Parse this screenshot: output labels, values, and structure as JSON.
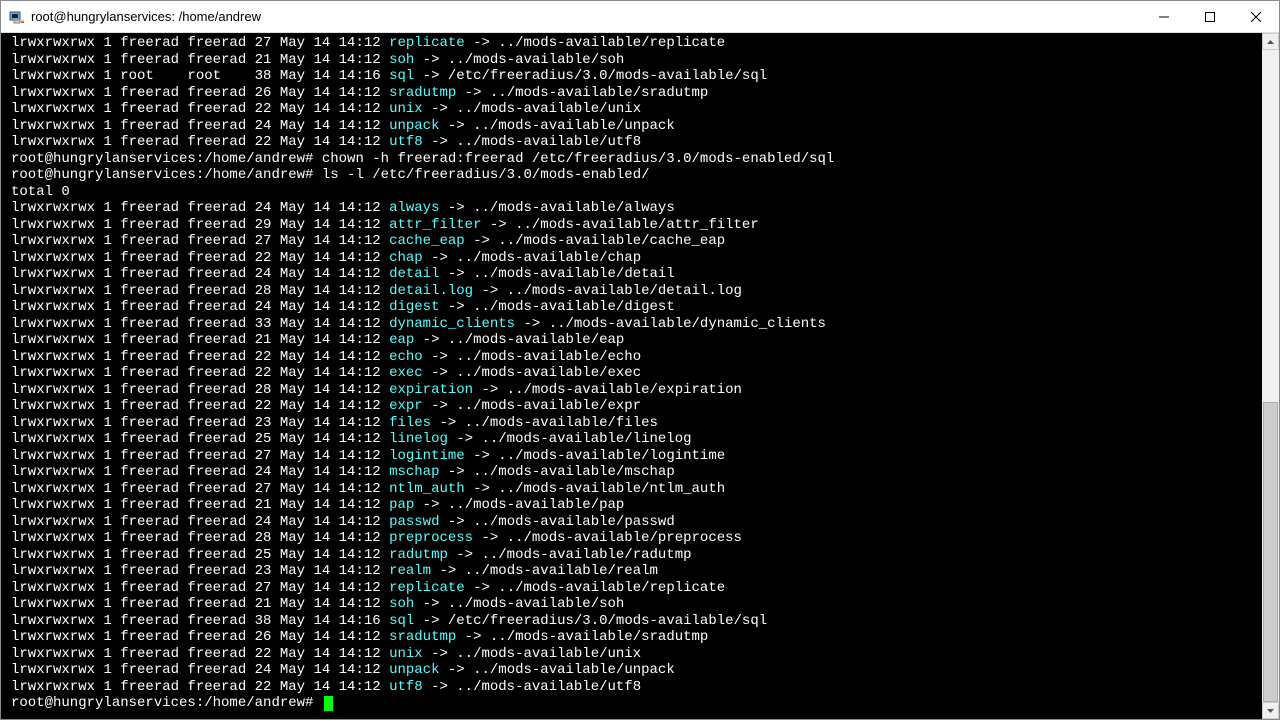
{
  "window": {
    "title": "root@hungrylanservices: /home/andrew"
  },
  "prompt": "root@hungrylanservices:/home/andrew#",
  "cmd_chown": "chown -h freerad:freerad /etc/freeradius/3.0/mods-enabled/sql",
  "cmd_ls": "ls -l /etc/freeradius/3.0/mods-enabled/",
  "total_line": "total 0",
  "top_lines": [
    {
      "perm": "lrwxrwxrwx 1 freerad freerad 27 May 14 14:12 ",
      "name": "replicate",
      "arrow": " -> ../mods-available/replicate"
    },
    {
      "perm": "lrwxrwxrwx 1 freerad freerad 21 May 14 14:12 ",
      "name": "soh",
      "arrow": " -> ../mods-available/soh"
    },
    {
      "perm": "lrwxrwxrwx 1 root    root    38 May 14 14:16 ",
      "name": "sql",
      "arrow": " -> /etc/freeradius/3.0/mods-available/sql"
    },
    {
      "perm": "lrwxrwxrwx 1 freerad freerad 26 May 14 14:12 ",
      "name": "sradutmp",
      "arrow": " -> ../mods-available/sradutmp"
    },
    {
      "perm": "lrwxrwxrwx 1 freerad freerad 22 May 14 14:12 ",
      "name": "unix",
      "arrow": " -> ../mods-available/unix"
    },
    {
      "perm": "lrwxrwxrwx 1 freerad freerad 24 May 14 14:12 ",
      "name": "unpack",
      "arrow": " -> ../mods-available/unpack"
    },
    {
      "perm": "lrwxrwxrwx 1 freerad freerad 22 May 14 14:12 ",
      "name": "utf8",
      "arrow": " -> ../mods-available/utf8"
    }
  ],
  "listing": [
    {
      "perm": "lrwxrwxrwx 1 freerad freerad 24 May 14 14:12 ",
      "name": "always",
      "arrow": " -> ../mods-available/always"
    },
    {
      "perm": "lrwxrwxrwx 1 freerad freerad 29 May 14 14:12 ",
      "name": "attr_filter",
      "arrow": " -> ../mods-available/attr_filter"
    },
    {
      "perm": "lrwxrwxrwx 1 freerad freerad 27 May 14 14:12 ",
      "name": "cache_eap",
      "arrow": " -> ../mods-available/cache_eap"
    },
    {
      "perm": "lrwxrwxrwx 1 freerad freerad 22 May 14 14:12 ",
      "name": "chap",
      "arrow": " -> ../mods-available/chap"
    },
    {
      "perm": "lrwxrwxrwx 1 freerad freerad 24 May 14 14:12 ",
      "name": "detail",
      "arrow": " -> ../mods-available/detail"
    },
    {
      "perm": "lrwxrwxrwx 1 freerad freerad 28 May 14 14:12 ",
      "name": "detail.log",
      "arrow": " -> ../mods-available/detail.log"
    },
    {
      "perm": "lrwxrwxrwx 1 freerad freerad 24 May 14 14:12 ",
      "name": "digest",
      "arrow": " -> ../mods-available/digest"
    },
    {
      "perm": "lrwxrwxrwx 1 freerad freerad 33 May 14 14:12 ",
      "name": "dynamic_clients",
      "arrow": " -> ../mods-available/dynamic_clients"
    },
    {
      "perm": "lrwxrwxrwx 1 freerad freerad 21 May 14 14:12 ",
      "name": "eap",
      "arrow": " -> ../mods-available/eap"
    },
    {
      "perm": "lrwxrwxrwx 1 freerad freerad 22 May 14 14:12 ",
      "name": "echo",
      "arrow": " -> ../mods-available/echo"
    },
    {
      "perm": "lrwxrwxrwx 1 freerad freerad 22 May 14 14:12 ",
      "name": "exec",
      "arrow": " -> ../mods-available/exec"
    },
    {
      "perm": "lrwxrwxrwx 1 freerad freerad 28 May 14 14:12 ",
      "name": "expiration",
      "arrow": " -> ../mods-available/expiration"
    },
    {
      "perm": "lrwxrwxrwx 1 freerad freerad 22 May 14 14:12 ",
      "name": "expr",
      "arrow": " -> ../mods-available/expr"
    },
    {
      "perm": "lrwxrwxrwx 1 freerad freerad 23 May 14 14:12 ",
      "name": "files",
      "arrow": " -> ../mods-available/files"
    },
    {
      "perm": "lrwxrwxrwx 1 freerad freerad 25 May 14 14:12 ",
      "name": "linelog",
      "arrow": " -> ../mods-available/linelog"
    },
    {
      "perm": "lrwxrwxrwx 1 freerad freerad 27 May 14 14:12 ",
      "name": "logintime",
      "arrow": " -> ../mods-available/logintime"
    },
    {
      "perm": "lrwxrwxrwx 1 freerad freerad 24 May 14 14:12 ",
      "name": "mschap",
      "arrow": " -> ../mods-available/mschap"
    },
    {
      "perm": "lrwxrwxrwx 1 freerad freerad 27 May 14 14:12 ",
      "name": "ntlm_auth",
      "arrow": " -> ../mods-available/ntlm_auth"
    },
    {
      "perm": "lrwxrwxrwx 1 freerad freerad 21 May 14 14:12 ",
      "name": "pap",
      "arrow": " -> ../mods-available/pap"
    },
    {
      "perm": "lrwxrwxrwx 1 freerad freerad 24 May 14 14:12 ",
      "name": "passwd",
      "arrow": " -> ../mods-available/passwd"
    },
    {
      "perm": "lrwxrwxrwx 1 freerad freerad 28 May 14 14:12 ",
      "name": "preprocess",
      "arrow": " -> ../mods-available/preprocess"
    },
    {
      "perm": "lrwxrwxrwx 1 freerad freerad 25 May 14 14:12 ",
      "name": "radutmp",
      "arrow": " -> ../mods-available/radutmp"
    },
    {
      "perm": "lrwxrwxrwx 1 freerad freerad 23 May 14 14:12 ",
      "name": "realm",
      "arrow": " -> ../mods-available/realm"
    },
    {
      "perm": "lrwxrwxrwx 1 freerad freerad 27 May 14 14:12 ",
      "name": "replicate",
      "arrow": " -> ../mods-available/replicate"
    },
    {
      "perm": "lrwxrwxrwx 1 freerad freerad 21 May 14 14:12 ",
      "name": "soh",
      "arrow": " -> ../mods-available/soh"
    },
    {
      "perm": "lrwxrwxrwx 1 freerad freerad 38 May 14 14:16 ",
      "name": "sql",
      "arrow": " -> /etc/freeradius/3.0/mods-available/sql"
    },
    {
      "perm": "lrwxrwxrwx 1 freerad freerad 26 May 14 14:12 ",
      "name": "sradutmp",
      "arrow": " -> ../mods-available/sradutmp"
    },
    {
      "perm": "lrwxrwxrwx 1 freerad freerad 22 May 14 14:12 ",
      "name": "unix",
      "arrow": " -> ../mods-available/unix"
    },
    {
      "perm": "lrwxrwxrwx 1 freerad freerad 24 May 14 14:12 ",
      "name": "unpack",
      "arrow": " -> ../mods-available/unpack"
    },
    {
      "perm": "lrwxrwxrwx 1 freerad freerad 22 May 14 14:12 ",
      "name": "utf8",
      "arrow": " -> ../mods-available/utf8"
    }
  ]
}
